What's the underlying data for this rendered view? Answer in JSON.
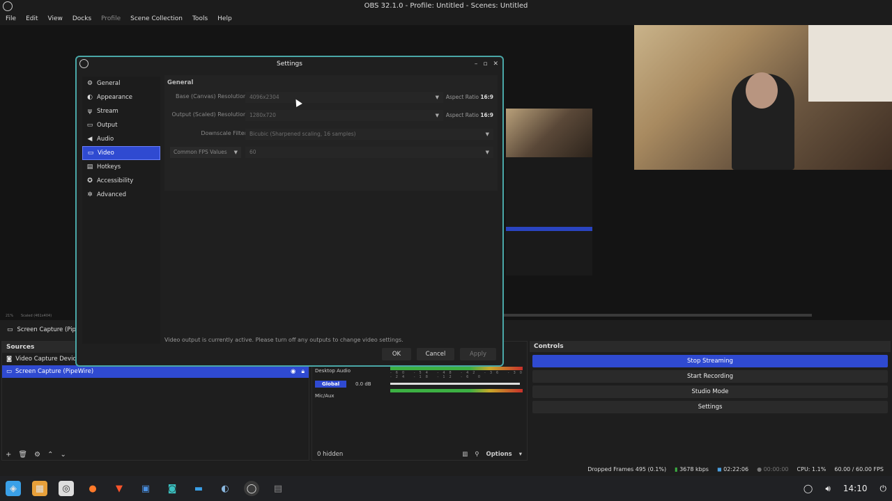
{
  "window": {
    "title": "OBS 32.1.0 - Profile: Untitled - Scenes: Untitled"
  },
  "menu": [
    "File",
    "Edit",
    "View",
    "Docks",
    "Profile",
    "Scene Collection",
    "Tools",
    "Help"
  ],
  "preview": {
    "zoom_label": "21%",
    "scaled_label": "Scaled (461x404)"
  },
  "source_label": "Screen Capture (PipeW",
  "sources": {
    "title": "Sources",
    "items": [
      {
        "label": "Video Capture Device"
      },
      {
        "label": "Screen Capture (PipeWire)"
      }
    ]
  },
  "mixer": {
    "channels": [
      {
        "name": "Desktop Audio"
      },
      {
        "name": "Global",
        "db": "0.0 dB"
      },
      {
        "name": "Mic/Aux"
      }
    ],
    "scale": "-60 -54 -48 -42 -36 -30 -24 -18 -12 -6 0",
    "hidden": "0 hidden",
    "options": "Options"
  },
  "controls": {
    "title": "Controls",
    "buttons": [
      "Stop Streaming",
      "Start Recording",
      "Studio Mode",
      "Settings"
    ]
  },
  "status": {
    "dropped": "Dropped Frames 495 (0.1%)",
    "kbps": "3678 kbps",
    "stream_time": "02:22:06",
    "rec_time": "00:00:00",
    "cpu": "CPU: 1.1%",
    "fps": "60.00 / 60.00 FPS"
  },
  "taskbar": {
    "clock": "14:10"
  },
  "settings": {
    "title": "Settings",
    "nav": [
      "General",
      "Appearance",
      "Stream",
      "Output",
      "Audio",
      "Video",
      "Hotkeys",
      "Accessibility",
      "Advanced"
    ],
    "selected": "Video",
    "group": "General",
    "base_label": "Base (Canvas) Resolution",
    "base_value": "4096x2304",
    "output_label": "Output (Scaled) Resolution",
    "output_value": "1280x720",
    "aspect_prefix": "Aspect Ratio",
    "aspect_value": "16:9",
    "downscale_label": "Downscale Filter",
    "downscale_value": "Bicubic (Sharpened scaling, 16 samples)",
    "fps_mode": "Common FPS Values",
    "fps_value": "60",
    "warning": "Video output is currently active. Please turn off any outputs to change video settings.",
    "ok": "OK",
    "cancel": "Cancel",
    "apply": "Apply"
  }
}
